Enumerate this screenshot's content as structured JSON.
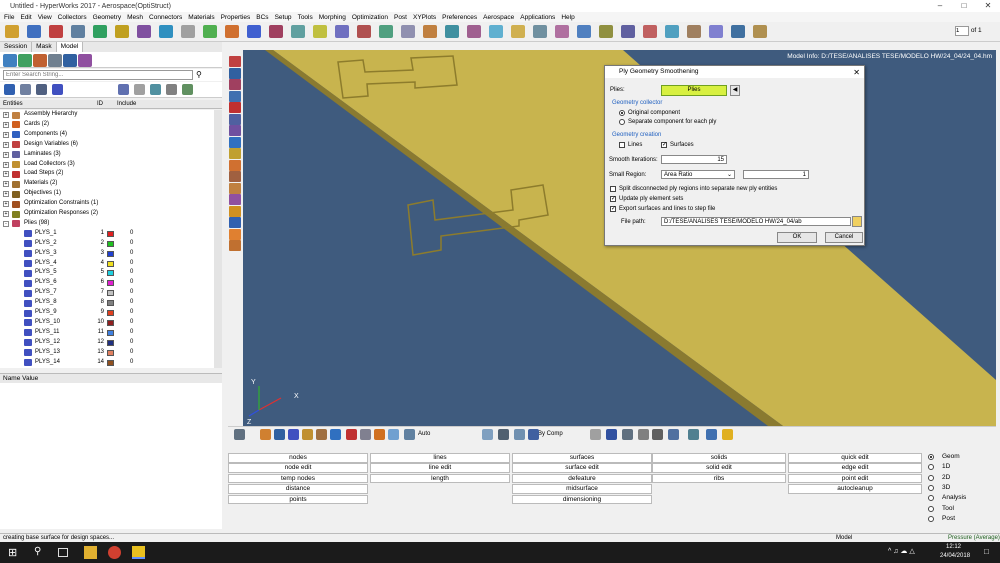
{
  "window": {
    "title": "Untitled - HyperWorks 2017 - Aerospace(OptiStruct)"
  },
  "menu": [
    "File",
    "Edit",
    "View",
    "Collectors",
    "Geometry",
    "Mesh",
    "Connectors",
    "Materials",
    "Properties",
    "BCs",
    "Setup",
    "Tools",
    "Morphing",
    "Optimization",
    "Post",
    "XYPlots",
    "Preferences",
    "Aerospace",
    "Applications",
    "Help"
  ],
  "toolbar": {
    "page_value": "1",
    "page_of": "of 1"
  },
  "left_tabs": [
    "Session",
    "Mask",
    "Model"
  ],
  "search": {
    "placeholder": "Enter Search String..."
  },
  "entities_header": {
    "col1": "Entities",
    "col2": "ID",
    "col3": "Include"
  },
  "tree": [
    {
      "label": "Assembly Hierarchy",
      "color": "#c08040"
    },
    {
      "label": "Cards (2)",
      "color": "#d06020"
    },
    {
      "label": "Components (4)",
      "color": "#3060c0"
    },
    {
      "label": "Design Variables (6)",
      "color": "#c04040"
    },
    {
      "label": "Laminates (3)",
      "color": "#6060a0"
    },
    {
      "label": "Load Collectors (3)",
      "color": "#c09030"
    },
    {
      "label": "Load Steps (2)",
      "color": "#c03030"
    },
    {
      "label": "Materials (2)",
      "color": "#a07030"
    },
    {
      "label": "Objectives (1)",
      "color": "#806020"
    },
    {
      "label": "Optimization Constraints (1)",
      "color": "#a05020"
    },
    {
      "label": "Optimization Responses (2)",
      "color": "#808020"
    },
    {
      "label": "Plies (98)",
      "color": "#c04060"
    }
  ],
  "plies": [
    {
      "name": "PLYS_1",
      "id": "1",
      "color": "#e02020",
      "inc": "0"
    },
    {
      "name": "PLYS_2",
      "id": "2",
      "color": "#20c020",
      "inc": "0"
    },
    {
      "name": "PLYS_3",
      "id": "3",
      "color": "#2040d0",
      "inc": "0"
    },
    {
      "name": "PLYS_4",
      "id": "4",
      "color": "#f0e020",
      "inc": "0"
    },
    {
      "name": "PLYS_5",
      "id": "5",
      "color": "#20d0e0",
      "inc": "0"
    },
    {
      "name": "PLYS_6",
      "id": "6",
      "color": "#e020d0",
      "inc": "0"
    },
    {
      "name": "PLYS_7",
      "id": "7",
      "color": "#c0c0c0",
      "inc": "0"
    },
    {
      "name": "PLYS_8",
      "id": "8",
      "color": "#808080",
      "inc": "0"
    },
    {
      "name": "PLYS_9",
      "id": "9",
      "color": "#e04020",
      "inc": "0"
    },
    {
      "name": "PLYS_10",
      "id": "10",
      "color": "#902020",
      "inc": "0"
    },
    {
      "name": "PLYS_11",
      "id": "11",
      "color": "#4080e0",
      "inc": "0"
    },
    {
      "name": "PLYS_12",
      "id": "12",
      "color": "#203080",
      "inc": "0"
    },
    {
      "name": "PLYS_13",
      "id": "13",
      "color": "#e08060",
      "inc": "0"
    },
    {
      "name": "PLYS_14",
      "id": "14",
      "color": "#905020",
      "inc": "0"
    }
  ],
  "name_value": {
    "header": "Name Value"
  },
  "viewport": {
    "model_info": "Model Info: D:/TESE/ANALISES TESE/MODELO HW/24_04/24_04.hm",
    "axis_x": "X",
    "axis_y": "Y",
    "axis_z": "Z"
  },
  "dialog": {
    "title": "Ply Geometry Smoothening",
    "plies_label": "Plies:",
    "plies_button": "Plies",
    "geom_collector": "Geometry collector",
    "opt_original": "Original component",
    "opt_separate": "Separate component for each ply",
    "geom_creation": "Geometry creation",
    "lines": "Lines",
    "surfaces": "Surfaces",
    "smooth_label": "Smooth Iterations:",
    "smooth_value": "15",
    "small_label": "Small Region:",
    "small_select": "Area Ratio",
    "small_value": "1",
    "split": "Split disconnected ply regions into separate new ply entities",
    "update": "Update ply element sets",
    "export": "Export surfaces and lines to step file",
    "file_label": "File path:",
    "file_value": "D:/TESE/ANALISES TESE/MODELO HW/24_04/ab",
    "ok": "OK",
    "cancel": "Cancel"
  },
  "bottom_toolbar": {
    "auto": "Auto",
    "bycomp": "By Comp"
  },
  "panel": {
    "col1": [
      "nodes",
      "node edit",
      "temp nodes",
      "distance",
      "points"
    ],
    "col2": [
      "lines",
      "line edit",
      "length"
    ],
    "col3": [
      "surfaces",
      "surface edit",
      "defeature",
      "midsurface",
      "dimensioning"
    ],
    "col4": [
      "solids",
      "solid edit",
      "ribs"
    ],
    "col5": [
      "quick edit",
      "edge edit",
      "point edit",
      "autocleanup"
    ]
  },
  "radio_panel": [
    "Geom",
    "1D",
    "2D",
    "3D",
    "Analysis",
    "Tool",
    "Post"
  ],
  "status": {
    "message": "creating base surface for design spaces...",
    "model": "Model",
    "loadcol": "Pressure (Average)"
  },
  "taskbar": {
    "time": "12:12",
    "date": "24/04/2018"
  }
}
